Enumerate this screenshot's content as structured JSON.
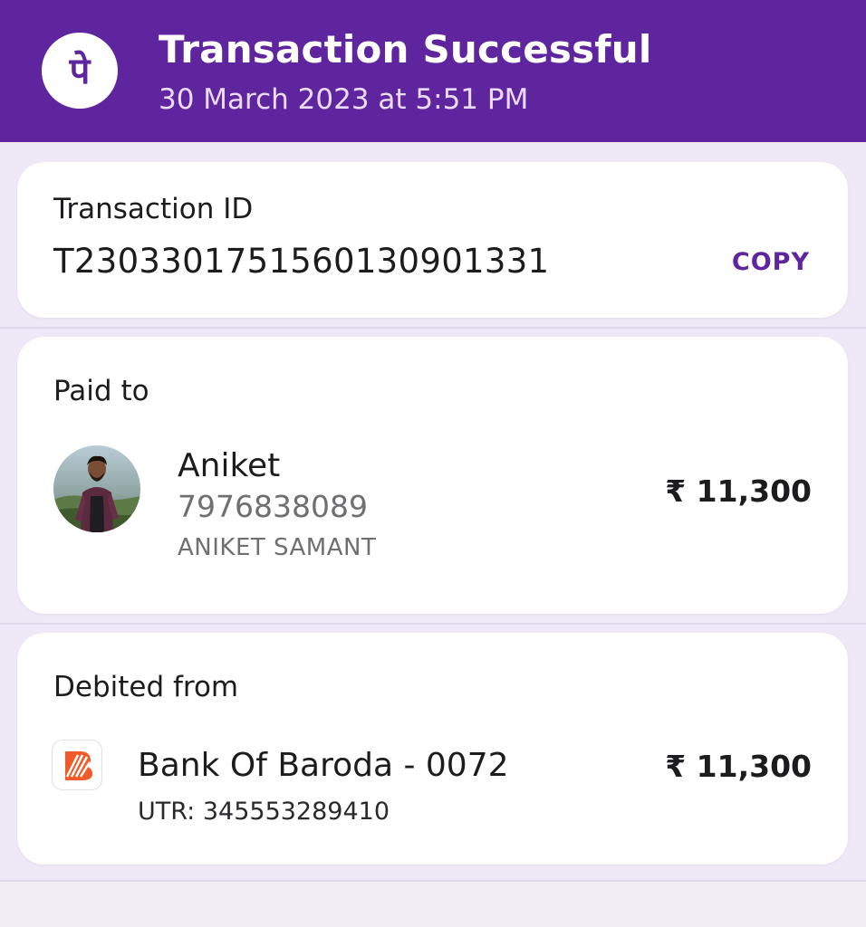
{
  "header": {
    "logo_glyph": "पे",
    "title": "Transaction Successful",
    "datetime": "30 March 2023 at 5:51 PM",
    "brand_color": "#5f259f"
  },
  "transaction": {
    "label": "Transaction ID",
    "id": "T2303301751560130901331",
    "copy_label": "COPY"
  },
  "paid_to": {
    "label": "Paid to",
    "name": "Aniket",
    "phone": "7976838089",
    "legal_name": "ANIKET SAMANT",
    "amount": "₹ 11,300",
    "avatar_icon": "profile-photo"
  },
  "debited_from": {
    "label": "Debited from",
    "bank": "Bank Of Baroda - 0072",
    "utr": "UTR: 345553289410",
    "amount": "₹ 11,300",
    "bank_icon": "bank-of-baroda-logo"
  }
}
